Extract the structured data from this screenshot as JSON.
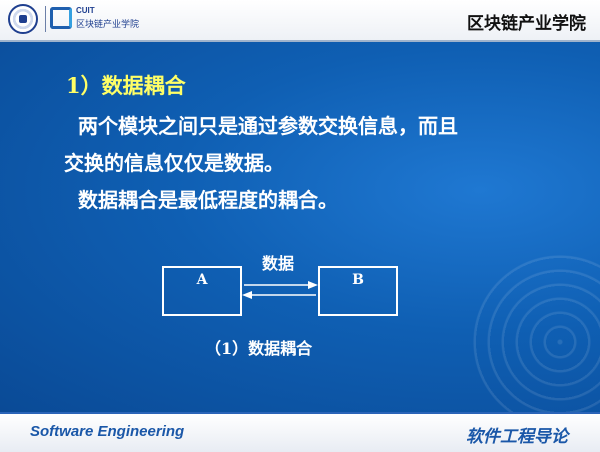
{
  "header": {
    "logo": {
      "abbr": "CUIT",
      "institute": "区块链产业学院"
    },
    "title": "区块链产业学院"
  },
  "slide": {
    "section_title": "1）数据耦合",
    "paragraph_lines": [
      "两个模块之间只是通过参数交换信息，而且",
      "交换的信息仅仅是数据。",
      "数据耦合是最低程度的耦合。"
    ],
    "diagram": {
      "module_a": "A",
      "module_b": "B",
      "arrow_label": "数据",
      "caption": "（1）数据耦合"
    }
  },
  "footer": {
    "left_text": "Software Engineering",
    "right_text": "软件工程导论"
  },
  "colors": {
    "slide_bg": "#0f5fb3",
    "title_yellow": "#ffff66",
    "footer_text": "#1a57a8"
  }
}
